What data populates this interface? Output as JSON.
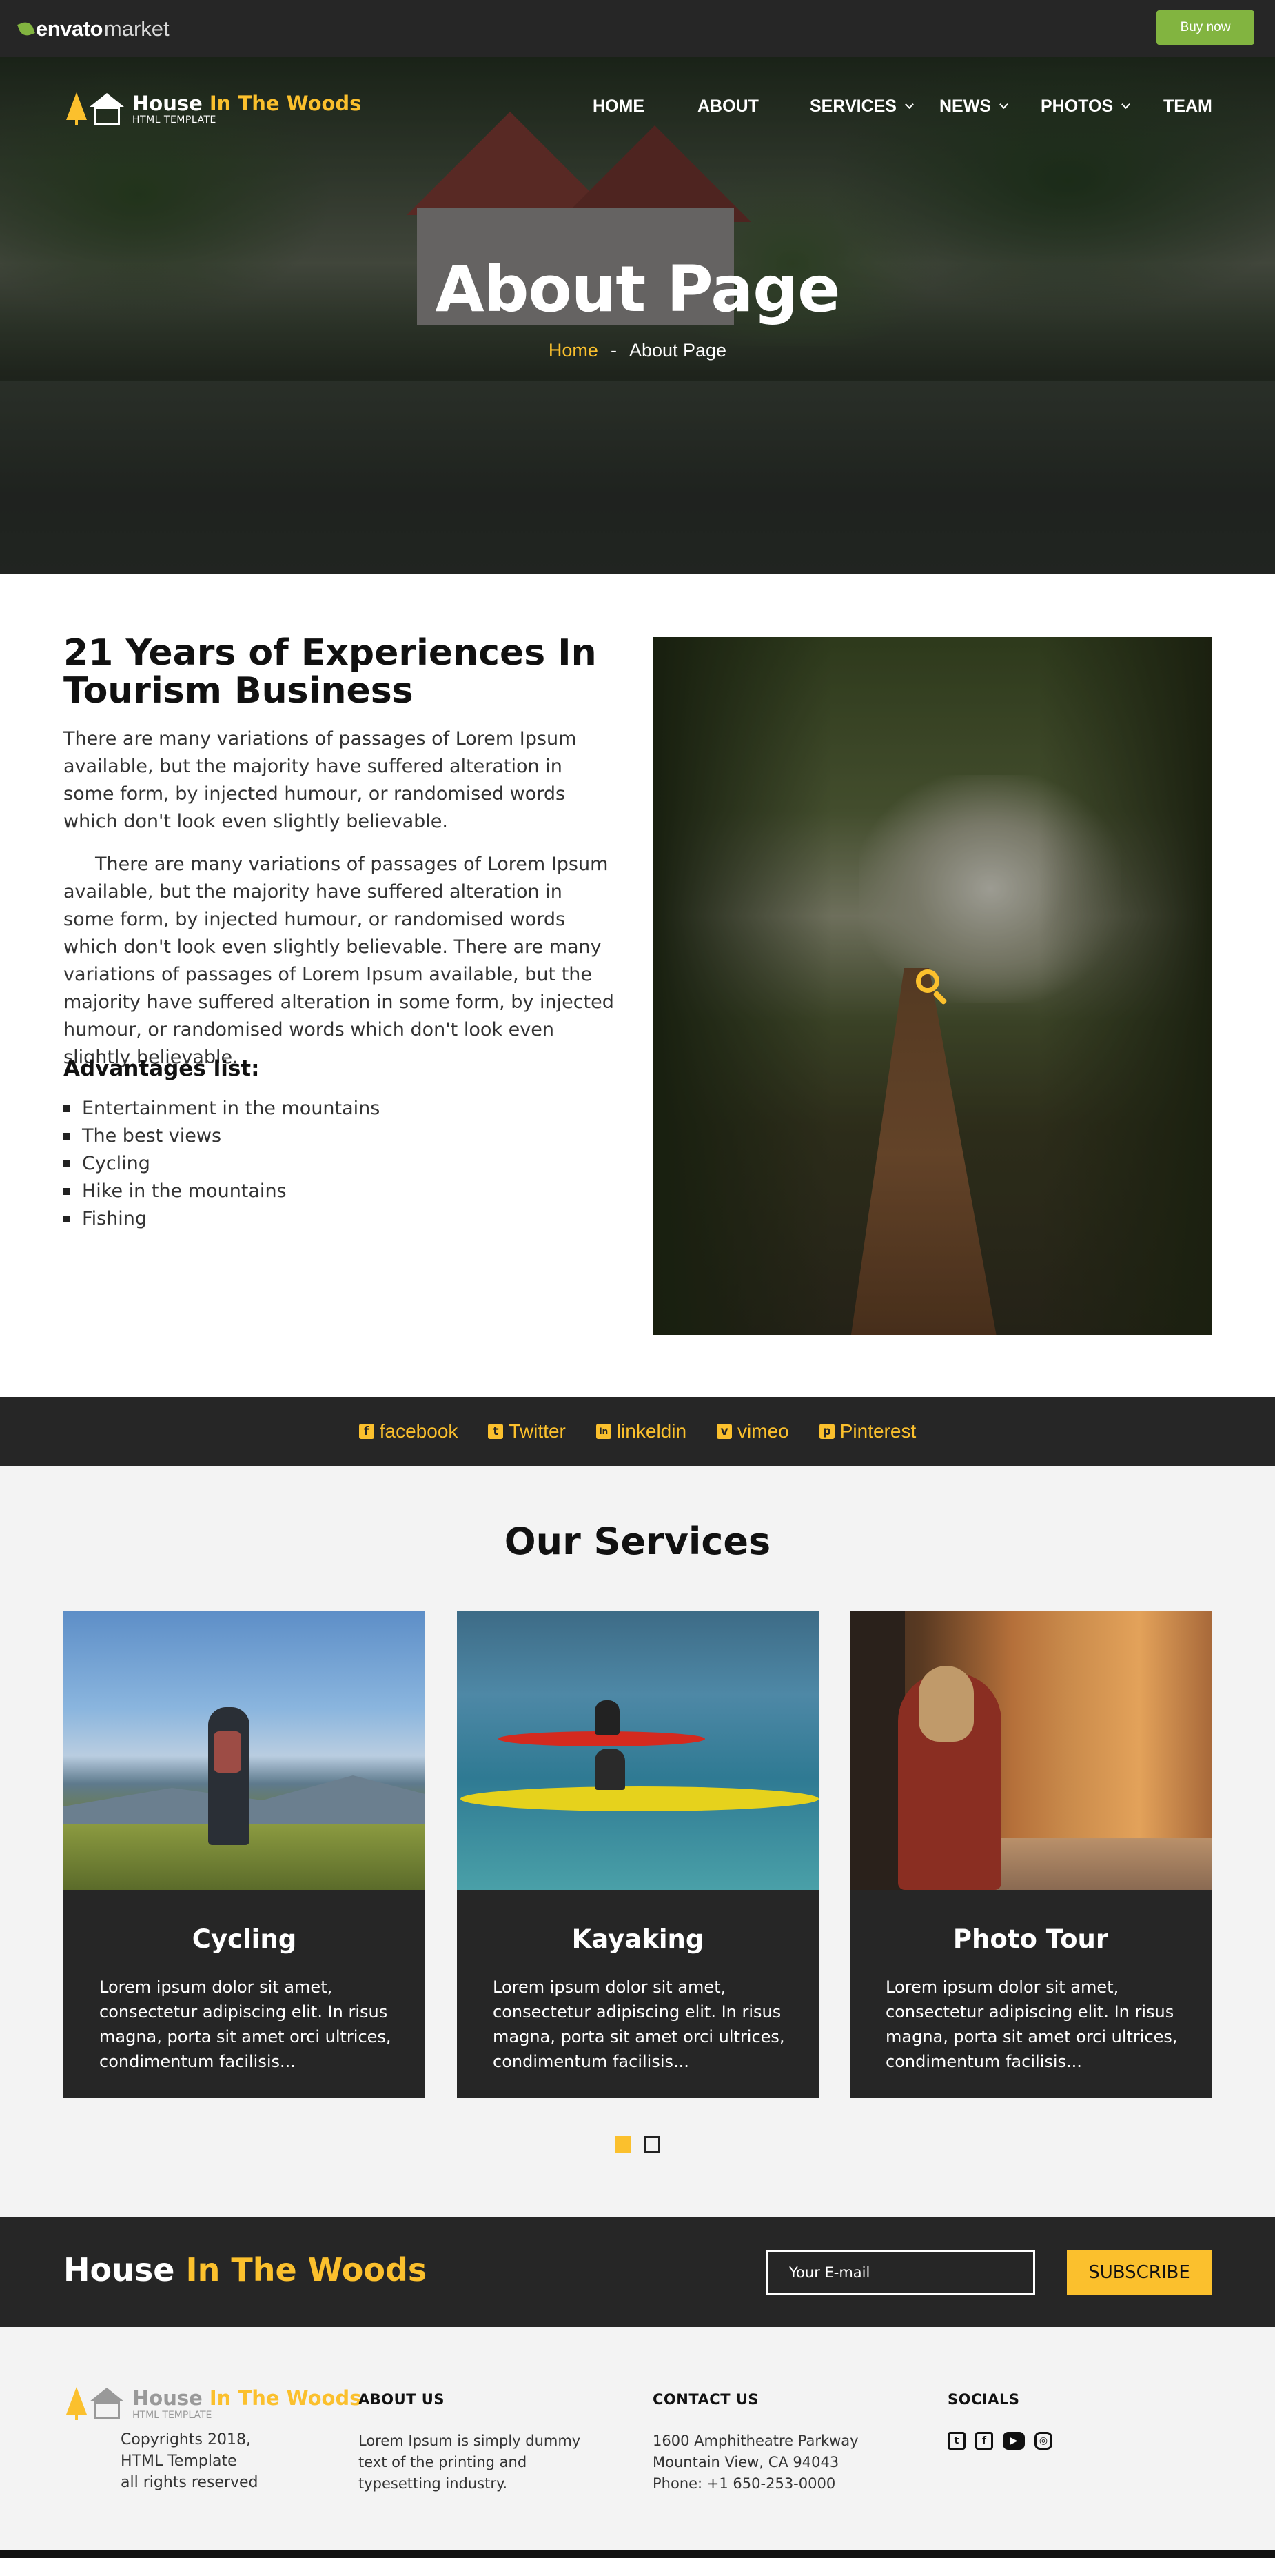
{
  "envato": {
    "brand_a": "envato",
    "brand_b": "market",
    "buy_label": "Buy now",
    "accent": "#82b440"
  },
  "brand": {
    "name_a": "House",
    "name_b": "In The Woods",
    "tagline": "HTML TEMPLATE",
    "accent": "#fbc02d"
  },
  "nav": {
    "home": "HOME",
    "about": "ABOUT",
    "services": "SERVICES",
    "news": "NEWS",
    "photos": "PHOTOS",
    "team": "TEAM"
  },
  "hero": {
    "title": "About Page",
    "crumb_home": "Home",
    "crumb_sep": "-",
    "crumb_current": "About Page"
  },
  "about": {
    "title": "21 Years of Experiences In Tourism Business",
    "p1": "There are many variations of passages of Lorem Ipsum available, but the majority have suffered alteration in some form, by injected humour, or randomised words which don't look even slightly believable.",
    "p2": "There are many variations of passages of Lorem Ipsum available, but the majority have suffered alteration in some form, by injected humour, or randomised words which don't look even slightly believable. There are many variations of passages of Lorem Ipsum available, but the majority have suffered alteration in some form, by injected humour, or randomised words which don't look even slightly believable.",
    "advantages_title": "Advantages list:",
    "advantages": [
      "Entertainment in the mountains",
      "The best views",
      "Cycling",
      "Hike in the mountains",
      "Fishing"
    ]
  },
  "social_strip": [
    {
      "icon": "f",
      "label": "facebook"
    },
    {
      "icon": "t",
      "label": "Twitter"
    },
    {
      "icon": "in",
      "label": "linkeldin"
    },
    {
      "icon": "v",
      "label": "vimeo"
    },
    {
      "icon": "p",
      "label": "Pinterest"
    }
  ],
  "services": {
    "title": "Our Services",
    "cards": [
      {
        "title": "Cycling",
        "text": "Lorem ipsum dolor sit amet, consectetur adipiscing elit. In risus magna, porta sit amet orci ultrices, condimentum facilisis..."
      },
      {
        "title": "Kayaking",
        "text": "Lorem ipsum dolor sit amet, consectetur adipiscing elit. In risus magna, porta sit amet orci ultrices, condimentum facilisis..."
      },
      {
        "title": "Photo Tour",
        "text": "Lorem ipsum dolor sit amet, consectetur adipiscing elit. In risus magna, porta sit amet orci ultrices, condimentum facilisis..."
      }
    ]
  },
  "subscribe": {
    "brand_a": "House",
    "brand_b": "In The Woods",
    "email_placeholder": "Your E-mail",
    "button": "SUBSCRIBE"
  },
  "footer": {
    "copyright": [
      "Copyrights 2018,",
      "HTML Template",
      "all rights reserved"
    ],
    "about_title": "ABOUT US",
    "about_text": [
      "Lorem Ipsum is simply dummy",
      "text of the printing and",
      "typesetting industry."
    ],
    "contact_title": "CONTACT US",
    "contact_text": [
      "1600 Amphitheatre Parkway",
      "Mountain View, CA 94043",
      "Phone: +1 650-253-0000"
    ],
    "socials_title": "SOCIALS",
    "socials": [
      "twitter-icon",
      "facebook-icon",
      "youtube-icon",
      "instagram-icon"
    ]
  }
}
